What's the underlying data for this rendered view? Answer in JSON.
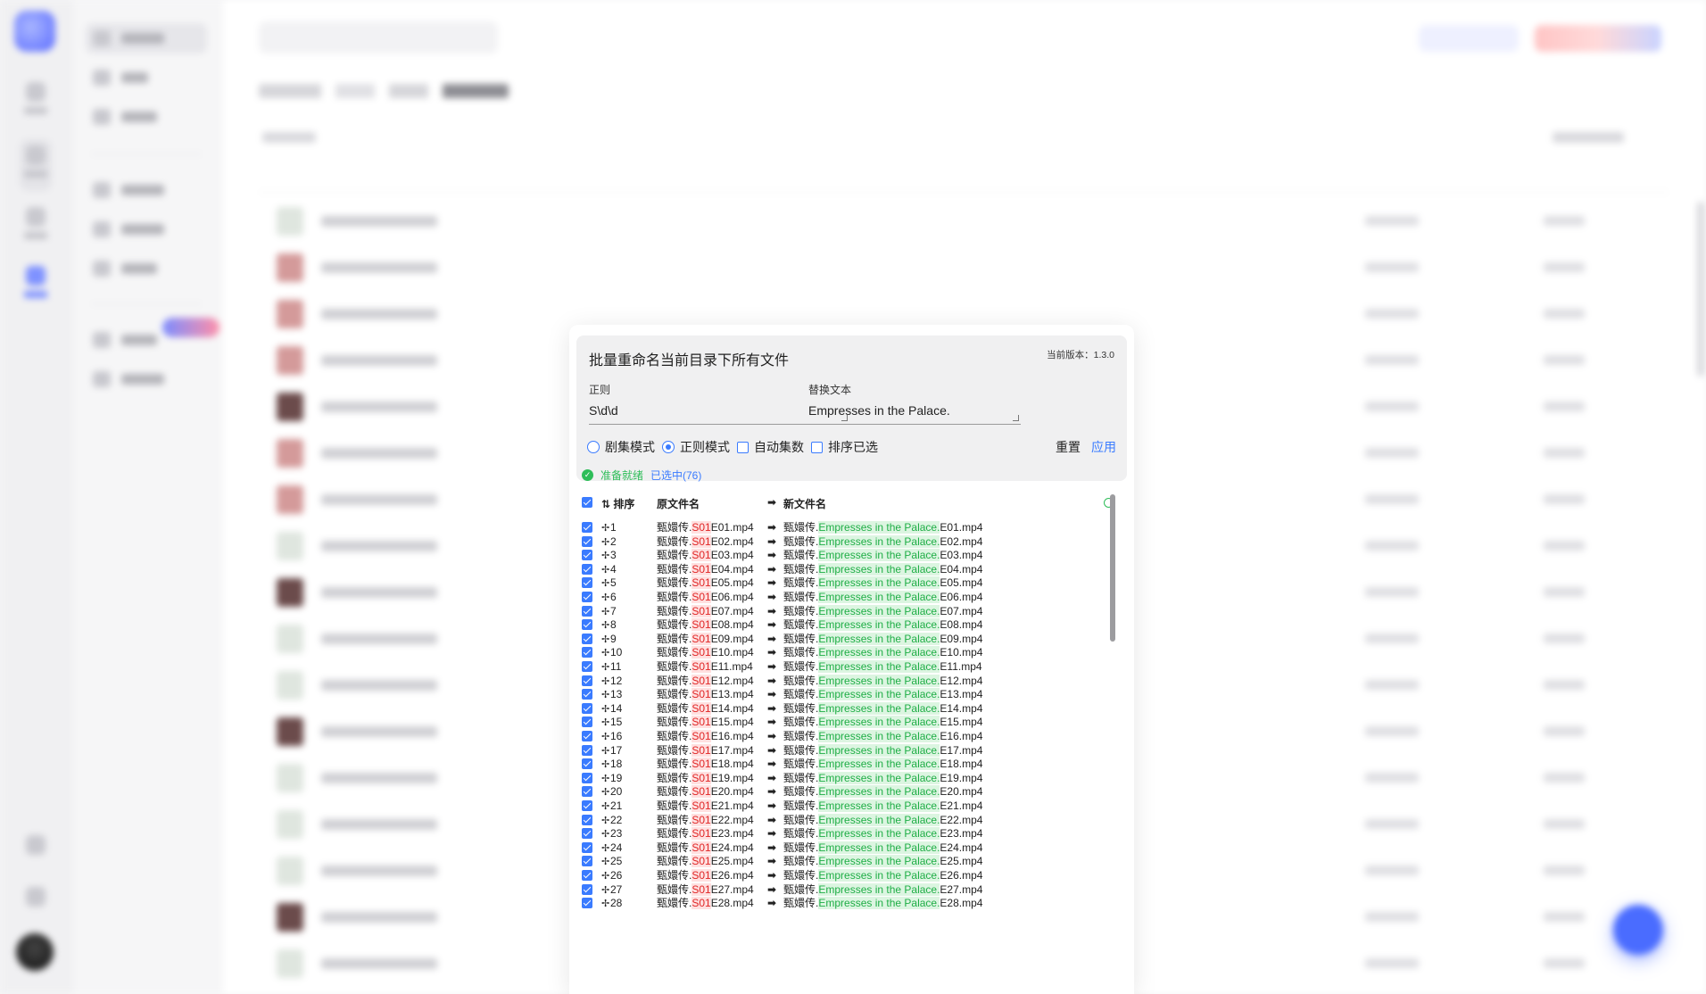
{
  "dialog": {
    "title": "批量重命名当前目录下所有文件",
    "version": "当前版本：1.3.0",
    "regex_label": "正则",
    "regex_value": "S\\d\\d",
    "replace_label": "替换文本",
    "replace_value": "Empresses in the Palace.",
    "options": {
      "episode_mode": "剧集模式",
      "regex_mode": "正则模式",
      "auto_episode": "自动集数",
      "sort_selected": "排序已选"
    },
    "reset_label": "重置",
    "apply_label": "应用",
    "status_ready": "准备就绪",
    "status_selected": "已选中(76)",
    "headers": {
      "sort": "排序",
      "original": "原文件名",
      "new": "新文件名"
    },
    "rows": [
      {
        "n": "1",
        "orig": [
          "甄嬛传.",
          "S01",
          "E01.mp4"
        ],
        "new": [
          "甄嬛传.",
          "Empresses in the Palace.",
          "E01.mp4"
        ]
      },
      {
        "n": "2",
        "orig": [
          "甄嬛传.",
          "S01",
          "E02.mp4"
        ],
        "new": [
          "甄嬛传.",
          "Empresses in the Palace.",
          "E02.mp4"
        ]
      },
      {
        "n": "3",
        "orig": [
          "甄嬛传.",
          "S01",
          "E03.mp4"
        ],
        "new": [
          "甄嬛传.",
          "Empresses in the Palace.",
          "E03.mp4"
        ]
      },
      {
        "n": "4",
        "orig": [
          "甄嬛传.",
          "S01",
          "E04.mp4"
        ],
        "new": [
          "甄嬛传.",
          "Empresses in the Palace.",
          "E04.mp4"
        ]
      },
      {
        "n": "5",
        "orig": [
          "甄嬛传.",
          "S01",
          "E05.mp4"
        ],
        "new": [
          "甄嬛传.",
          "Empresses in the Palace.",
          "E05.mp4"
        ]
      },
      {
        "n": "6",
        "orig": [
          "甄嬛传.",
          "S01",
          "E06.mp4"
        ],
        "new": [
          "甄嬛传.",
          "Empresses in the Palace.",
          "E06.mp4"
        ]
      },
      {
        "n": "7",
        "orig": [
          "甄嬛传.",
          "S01",
          "E07.mp4"
        ],
        "new": [
          "甄嬛传.",
          "Empresses in the Palace.",
          "E07.mp4"
        ]
      },
      {
        "n": "8",
        "orig": [
          "甄嬛传.",
          "S01",
          "E08.mp4"
        ],
        "new": [
          "甄嬛传.",
          "Empresses in the Palace.",
          "E08.mp4"
        ]
      },
      {
        "n": "9",
        "orig": [
          "甄嬛传.",
          "S01",
          "E09.mp4"
        ],
        "new": [
          "甄嬛传.",
          "Empresses in the Palace.",
          "E09.mp4"
        ]
      },
      {
        "n": "10",
        "orig": [
          "甄嬛传.",
          "S01",
          "E10.mp4"
        ],
        "new": [
          "甄嬛传.",
          "Empresses in the Palace.",
          "E10.mp4"
        ]
      },
      {
        "n": "11",
        "orig": [
          "甄嬛传.",
          "S01",
          "E11.mp4"
        ],
        "new": [
          "甄嬛传.",
          "Empresses in the Palace.",
          "E11.mp4"
        ]
      },
      {
        "n": "12",
        "orig": [
          "甄嬛传.",
          "S01",
          "E12.mp4"
        ],
        "new": [
          "甄嬛传.",
          "Empresses in the Palace.",
          "E12.mp4"
        ]
      },
      {
        "n": "13",
        "orig": [
          "甄嬛传.",
          "S01",
          "E13.mp4"
        ],
        "new": [
          "甄嬛传.",
          "Empresses in the Palace.",
          "E13.mp4"
        ]
      },
      {
        "n": "14",
        "orig": [
          "甄嬛传.",
          "S01",
          "E14.mp4"
        ],
        "new": [
          "甄嬛传.",
          "Empresses in the Palace.",
          "E14.mp4"
        ]
      },
      {
        "n": "15",
        "orig": [
          "甄嬛传.",
          "S01",
          "E15.mp4"
        ],
        "new": [
          "甄嬛传.",
          "Empresses in the Palace.",
          "E15.mp4"
        ]
      },
      {
        "n": "16",
        "orig": [
          "甄嬛传.",
          "S01",
          "E16.mp4"
        ],
        "new": [
          "甄嬛传.",
          "Empresses in the Palace.",
          "E16.mp4"
        ]
      },
      {
        "n": "17",
        "orig": [
          "甄嬛传.",
          "S01",
          "E17.mp4"
        ],
        "new": [
          "甄嬛传.",
          "Empresses in the Palace.",
          "E17.mp4"
        ]
      },
      {
        "n": "18",
        "orig": [
          "甄嬛传.",
          "S01",
          "E18.mp4"
        ],
        "new": [
          "甄嬛传.",
          "Empresses in the Palace.",
          "E18.mp4"
        ]
      },
      {
        "n": "19",
        "orig": [
          "甄嬛传.",
          "S01",
          "E19.mp4"
        ],
        "new": [
          "甄嬛传.",
          "Empresses in the Palace.",
          "E19.mp4"
        ]
      },
      {
        "n": "20",
        "orig": [
          "甄嬛传.",
          "S01",
          "E20.mp4"
        ],
        "new": [
          "甄嬛传.",
          "Empresses in the Palace.",
          "E20.mp4"
        ]
      },
      {
        "n": "21",
        "orig": [
          "甄嬛传.",
          "S01",
          "E21.mp4"
        ],
        "new": [
          "甄嬛传.",
          "Empresses in the Palace.",
          "E21.mp4"
        ]
      },
      {
        "n": "22",
        "orig": [
          "甄嬛传.",
          "S01",
          "E22.mp4"
        ],
        "new": [
          "甄嬛传.",
          "Empresses in the Palace.",
          "E22.mp4"
        ]
      },
      {
        "n": "23",
        "orig": [
          "甄嬛传.",
          "S01",
          "E23.mp4"
        ],
        "new": [
          "甄嬛传.",
          "Empresses in the Palace.",
          "E23.mp4"
        ]
      },
      {
        "n": "24",
        "orig": [
          "甄嬛传.",
          "S01",
          "E24.mp4"
        ],
        "new": [
          "甄嬛传.",
          "Empresses in the Palace.",
          "E24.mp4"
        ]
      },
      {
        "n": "25",
        "orig": [
          "甄嬛传.",
          "S01",
          "E25.mp4"
        ],
        "new": [
          "甄嬛传.",
          "Empresses in the Palace.",
          "E25.mp4"
        ]
      },
      {
        "n": "26",
        "orig": [
          "甄嬛传.",
          "S01",
          "E26.mp4"
        ],
        "new": [
          "甄嬛传.",
          "Empresses in the Palace.",
          "E26.mp4"
        ]
      },
      {
        "n": "27",
        "orig": [
          "甄嬛传.",
          "S01",
          "E27.mp4"
        ],
        "new": [
          "甄嬛传.",
          "Empresses in the Palace.",
          "E27.mp4"
        ]
      },
      {
        "n": "28",
        "orig": [
          "甄嬛传.",
          "S01",
          "E28.mp4"
        ],
        "new": [
          "甄嬛传.",
          "Empresses in the Palace.",
          "E28.mp4"
        ]
      }
    ]
  },
  "icons": {
    "drag": "✢",
    "arrow": "➡",
    "check": "✓",
    "sort": "⇅"
  },
  "colors": {
    "accent": "#3a7bff",
    "success": "#2ebd59",
    "removed": "#e02626",
    "added": "#1fae46"
  }
}
